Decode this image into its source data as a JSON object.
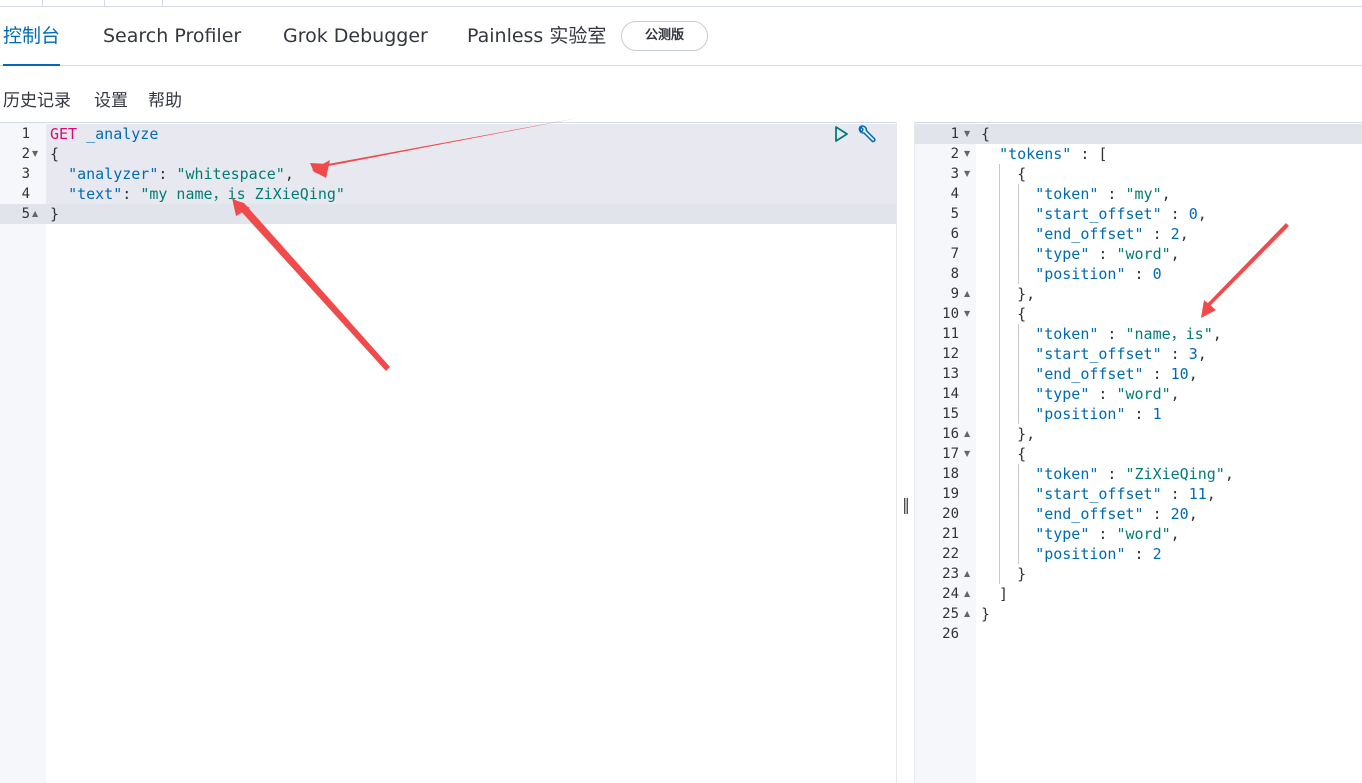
{
  "tabs": [
    {
      "label": "控制台",
      "selected": true
    },
    {
      "label": "Search Profiler"
    },
    {
      "label": "Grok Debugger"
    },
    {
      "label": "Painless 实验室"
    }
  ],
  "beta_badge": "公测版",
  "menu": {
    "history": "历史记录",
    "settings": "设置",
    "help": "帮助"
  },
  "request": {
    "line_numbers": [
      "1",
      "2",
      "3",
      "4",
      "5"
    ],
    "method": "GET",
    "path": "_analyze",
    "open_brace": "{",
    "close_brace": "}",
    "analyzer_key": "\"analyzer\"",
    "analyzer_value": "\"whitespace\"",
    "text_key": "\"text\"",
    "text_value": "\"my name，is ZiXieQing\""
  },
  "response": {
    "line_numbers": [
      "1",
      "2",
      "3",
      "4",
      "5",
      "6",
      "7",
      "8",
      "9",
      "10",
      "11",
      "12",
      "13",
      "14",
      "15",
      "16",
      "17",
      "18",
      "19",
      "20",
      "21",
      "22",
      "23",
      "24",
      "25",
      "26"
    ],
    "tokens_key": "\"tokens\"",
    "tokens": [
      {
        "token": "\"my\"",
        "start_offset": "0",
        "end_offset": "2",
        "type": "\"word\"",
        "position": "0"
      },
      {
        "token": "\"name，is\"",
        "start_offset": "3",
        "end_offset": "10",
        "type": "\"word\"",
        "position": "1"
      },
      {
        "token": "\"ZiXieQing\"",
        "start_offset": "11",
        "end_offset": "20",
        "type": "\"word\"",
        "position": "2"
      }
    ],
    "keys": {
      "token": "\"token\"",
      "start_offset": "\"start_offset\"",
      "end_offset": "\"end_offset\"",
      "type": "\"type\"",
      "position": "\"position\""
    }
  },
  "colors": {
    "accent": "#006bb4",
    "string": "#017d73",
    "method": "#dd0a73",
    "arrow": "#f04a4a"
  },
  "icons": [
    "play-icon",
    "wrench-icon",
    "resize-grip-icon",
    "fold-arrow-icon"
  ]
}
